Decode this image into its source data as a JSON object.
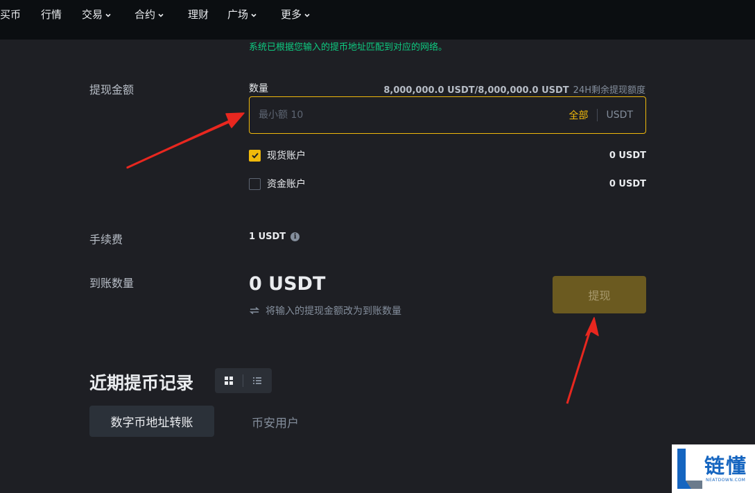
{
  "nav": {
    "items": [
      {
        "label": "买币",
        "has_menu": false
      },
      {
        "label": "行情",
        "has_menu": false
      },
      {
        "label": "交易",
        "has_menu": true
      },
      {
        "label": "合约",
        "has_menu": true
      },
      {
        "label": "理财",
        "has_menu": false
      },
      {
        "label": "广场",
        "has_menu": true
      },
      {
        "label": "更多",
        "has_menu": true
      }
    ]
  },
  "notice": "系统已根据您输入的提币地址匹配到对应的网络。",
  "withdraw_amount": {
    "section_label": "提现金额",
    "quantity_label": "数量",
    "limit_amount": "8,000,000.0 USDT/8,000,000.0 USDT",
    "limit_desc": "24H剩余提现额度",
    "input": {
      "value": "",
      "placeholder": "最小额 10"
    },
    "max_label": "全部",
    "unit": "USDT"
  },
  "accounts": [
    {
      "name": "现货账户",
      "value": "0 USDT",
      "checked": true
    },
    {
      "name": "资金账户",
      "value": "0 USDT",
      "checked": false
    }
  ],
  "fee": {
    "label": "手续费",
    "value": "1 USDT",
    "icon": "info-icon"
  },
  "receive": {
    "label": "到账数量",
    "value": "0 USDT",
    "swap_text": "将输入的提现金额改为到账数量",
    "swap_icon": "swap-icon"
  },
  "withdraw_button": "提现",
  "history": {
    "title": "近期提币记录",
    "view_icons": [
      "grid-view-icon",
      "list-view-icon"
    ],
    "tabs": [
      "数字币地址转账",
      "币安用户"
    ],
    "active_tab": 0
  },
  "watermark": {
    "text": "链懂",
    "sub": "NEATDOWN.COM"
  },
  "colors": {
    "accent": "#f0b90b",
    "success": "#0ecb81",
    "annotation_arrow": "#e8271f",
    "watermark": "#1565c0",
    "background": "#1e1f24",
    "nav_background": "#0b0e11"
  }
}
